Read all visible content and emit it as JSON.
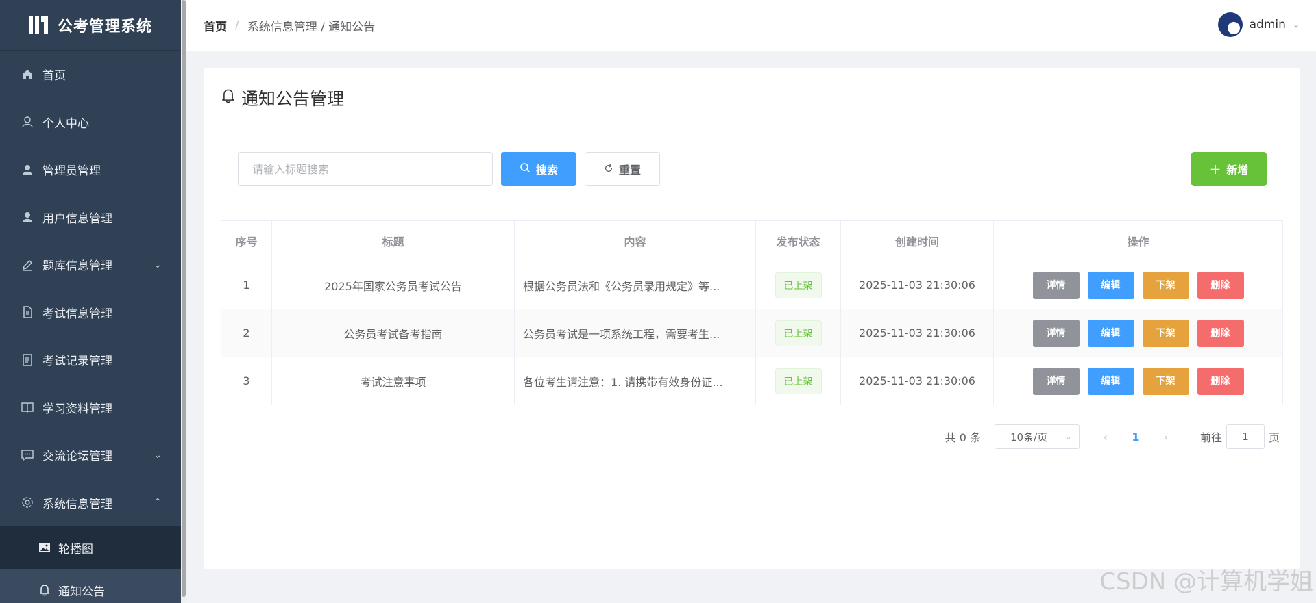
{
  "app": {
    "title": "公考管理系统"
  },
  "sidebar": {
    "items": [
      {
        "label": "首页",
        "icon": "home-icon"
      },
      {
        "label": "个人中心",
        "icon": "user-outline-icon"
      },
      {
        "label": "管理员管理",
        "icon": "user-icon"
      },
      {
        "label": "用户信息管理",
        "icon": "user-icon"
      },
      {
        "label": "题库信息管理",
        "icon": "edit-icon",
        "expandable": true
      },
      {
        "label": "考试信息管理",
        "icon": "document-icon"
      },
      {
        "label": "考试记录管理",
        "icon": "notes-icon"
      },
      {
        "label": "学习资料管理",
        "icon": "book-icon"
      },
      {
        "label": "交流论坛管理",
        "icon": "chat-icon",
        "expandable": true
      },
      {
        "label": "系统信息管理",
        "icon": "gear-icon",
        "expanded": true
      }
    ],
    "sub_items": [
      {
        "label": "轮播图",
        "icon": "image-icon"
      },
      {
        "label": "通知公告",
        "icon": "bell-icon",
        "active": true
      }
    ]
  },
  "header": {
    "breadcrumb": {
      "home": "首页",
      "sep": "/",
      "path": "系统信息管理 / 通知公告"
    },
    "user": "admin"
  },
  "page": {
    "title": "通知公告管理",
    "search": {
      "placeholder": "请输入标题搜索",
      "value": ""
    },
    "buttons": {
      "search": "搜索",
      "reset": "重置",
      "add": "新增"
    }
  },
  "table": {
    "columns": [
      "序号",
      "标题",
      "内容",
      "发布状态",
      "创建时间",
      "操作"
    ],
    "rows": [
      {
        "no": "1",
        "title": "2025年国家公务员考试公告",
        "content": "根据公务员法和《公务员录用规定》等...",
        "status": "已上架",
        "time": "2025-11-03 21:30:06"
      },
      {
        "no": "2",
        "title": "公务员考试备考指南",
        "content": "公务员考试是一项系统工程，需要考生...",
        "status": "已上架",
        "time": "2025-11-03 21:30:06"
      },
      {
        "no": "3",
        "title": "考试注意事项",
        "content": "各位考生请注意：1. 请携带有效身份证...",
        "status": "已上架",
        "time": "2025-11-03 21:30:06"
      }
    ],
    "actions": {
      "detail": "详情",
      "edit": "编辑",
      "off": "下架",
      "delete": "删除"
    }
  },
  "pagination": {
    "total": "共 0 条",
    "page_size": "10条/页",
    "current": "1",
    "goto_label": "前往",
    "goto_value": "1",
    "page_suffix": "页"
  },
  "watermark": "CSDN @计算机学姐",
  "colors": {
    "sidebar": "#304156",
    "primary": "#409eff",
    "success": "#67c23a",
    "warning": "#e6a23c",
    "danger": "#f56c6c",
    "info": "#909399"
  }
}
